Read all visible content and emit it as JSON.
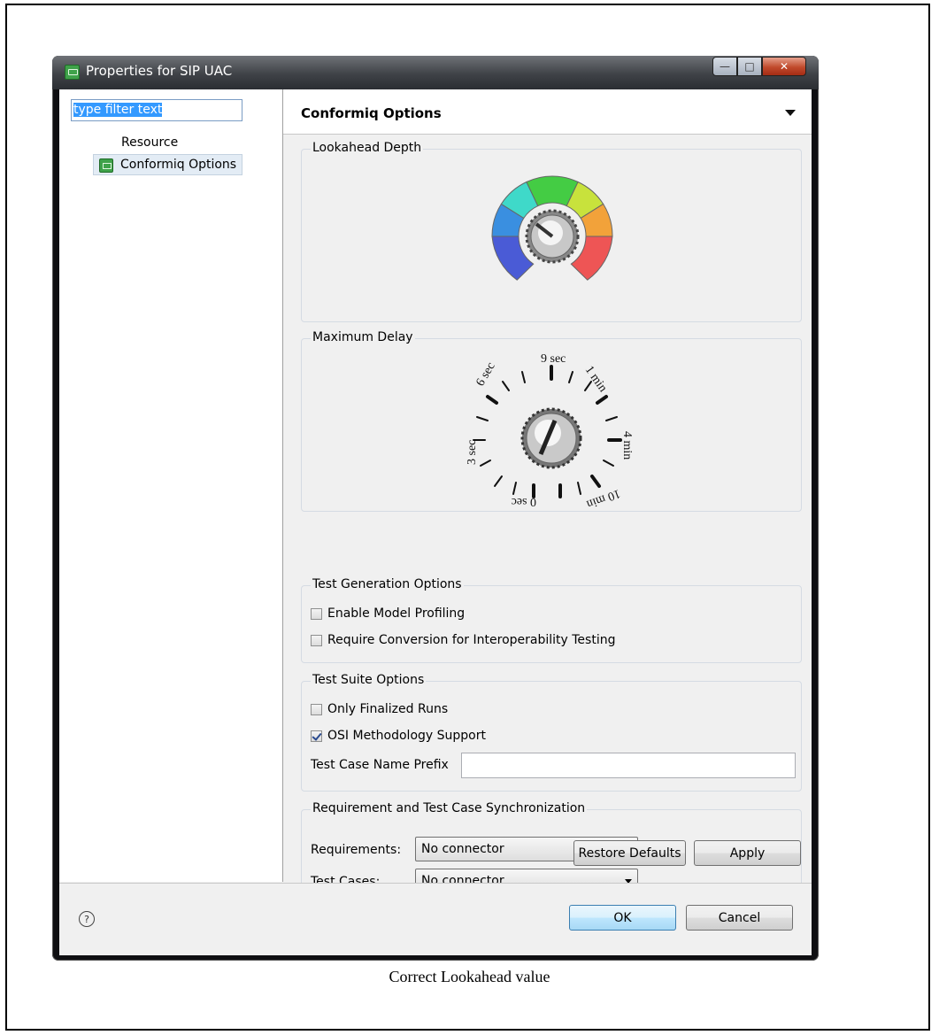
{
  "window": {
    "title": "Properties for SIP UAC"
  },
  "left": {
    "filter_text": "type filter text",
    "tree": [
      {
        "label": "Resource"
      },
      {
        "label": "Conformiq Options",
        "selected": true
      }
    ]
  },
  "page": {
    "title": "Conformiq Options",
    "lookahead": {
      "label": "Lookahead Depth"
    },
    "delay": {
      "label": "Maximum Delay",
      "dial_labels": {
        "sec3": "3 sec",
        "sec6": "6 sec",
        "sec9": "9 sec",
        "min1": "1 min",
        "min4": "4 min",
        "min10": "10 min",
        "zero": "0 sec"
      }
    },
    "test_generation": {
      "label": "Test Generation Options",
      "profiling": {
        "label": "Enable Model Profiling",
        "checked": false
      },
      "conversion": {
        "label": "Require Conversion for Interoperability Testing",
        "checked": false
      }
    },
    "test_suite": {
      "label": "Test Suite Options",
      "finalized": {
        "label": "Only Finalized Runs",
        "checked": false
      },
      "osi": {
        "label": "OSI Methodology Support",
        "checked": true
      },
      "prefix_label": "Test Case Name Prefix",
      "prefix_value": ""
    },
    "sync": {
      "label": "Requirement and Test Case Synchronization",
      "requirements_label": "Requirements:",
      "requirements_value": "No connector",
      "testcases_label": "Test Cases:",
      "testcases_value": "No connector"
    },
    "restore_label": "Restore Defaults",
    "apply_label": "Apply"
  },
  "buttons": {
    "help": "?",
    "ok": "OK",
    "cancel": "Cancel"
  },
  "caption": "Correct Lookahead value"
}
